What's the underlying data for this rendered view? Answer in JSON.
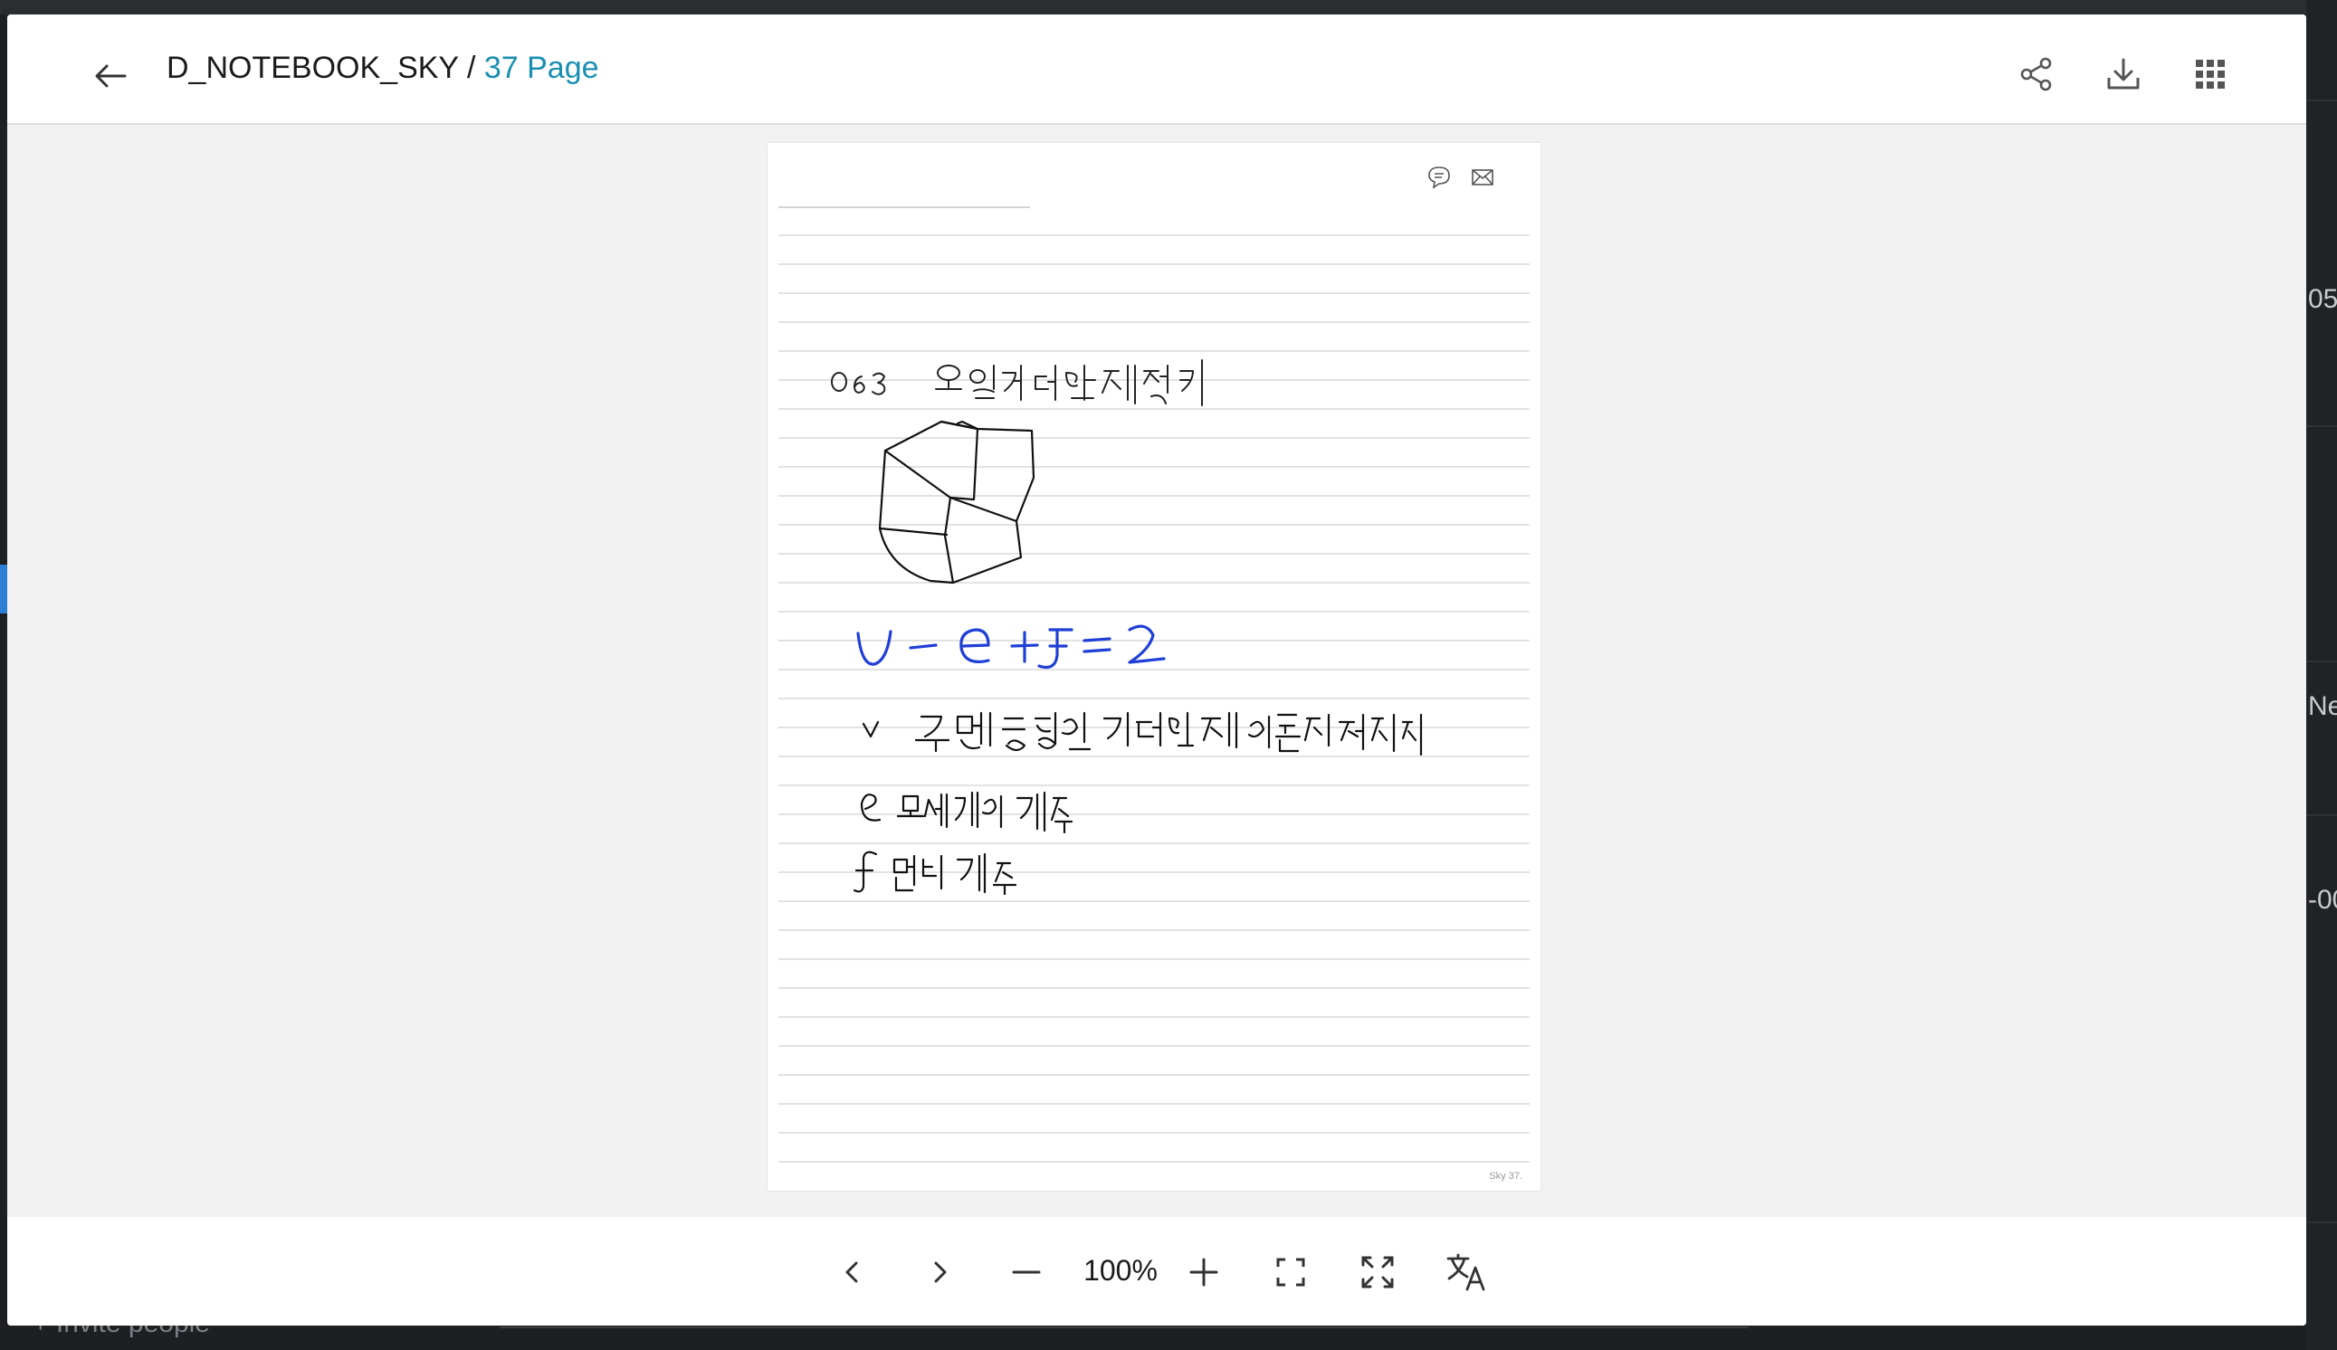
{
  "header": {
    "back_icon": "arrow-left-icon",
    "notebook_name": "D_NOTEBOOK_SKY",
    "separator": " / ",
    "page_label": "37 Page",
    "share_icon": "share-icon",
    "download_icon": "download-icon",
    "grid_icon": "grid-icon"
  },
  "page": {
    "chat_icon": "comment-icon",
    "mail_icon": "mail-icon",
    "footer_label": "Sky 37.",
    "handwriting": {
      "title": "063 오일러다면체정리",
      "formula": "v − e + f = 2",
      "line_v": "v 구면과 동형인 다면체의 꼭짓점의 개수",
      "line_e": "e 모서리의 개수",
      "line_f": "f 면의 개수"
    }
  },
  "toolbar": {
    "prev_icon": "chevron-left-icon",
    "next_icon": "chevron-right-icon",
    "zoom_out_icon": "minus-icon",
    "zoom_value": "100%",
    "zoom_in_icon": "plus-icon",
    "fit_icon": "fit-page-icon",
    "fullscreen_icon": "fullscreen-icon",
    "translate_icon": "translate-icon"
  },
  "background": {
    "right_texts": [
      "05",
      "Ne",
      "-00"
    ],
    "bottom_text": "+ Invite people"
  },
  "colors": {
    "accent": "#1a8fb1",
    "ink_black": "#111111",
    "ink_blue": "#1f3fd6"
  }
}
